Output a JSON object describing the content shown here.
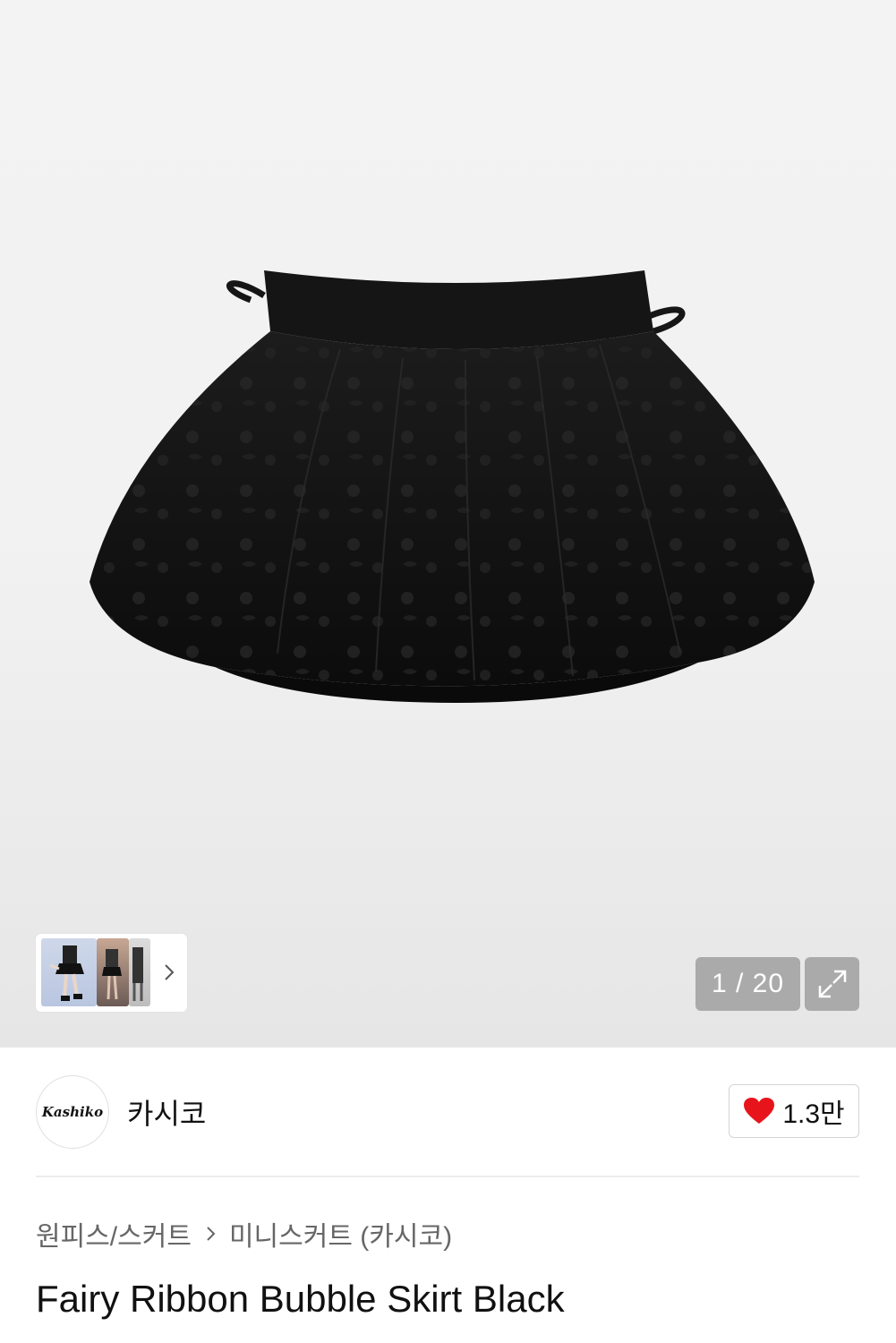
{
  "gallery": {
    "counter": "1 / 20",
    "image_alt": "skirt-product-photo",
    "thumbnails": [
      "model-photo",
      "model-photo-2",
      "model-photo-3"
    ]
  },
  "brand": {
    "logo_text": "Kashiko",
    "name": "카시코",
    "likes": "1.3만",
    "like_color": "#e8141c"
  },
  "breadcrumb": {
    "category": "원피스/스커트",
    "subcategory": "미니스커트 (카시코)"
  },
  "product": {
    "title": "Fairy Ribbon Bubble Skirt Black"
  }
}
